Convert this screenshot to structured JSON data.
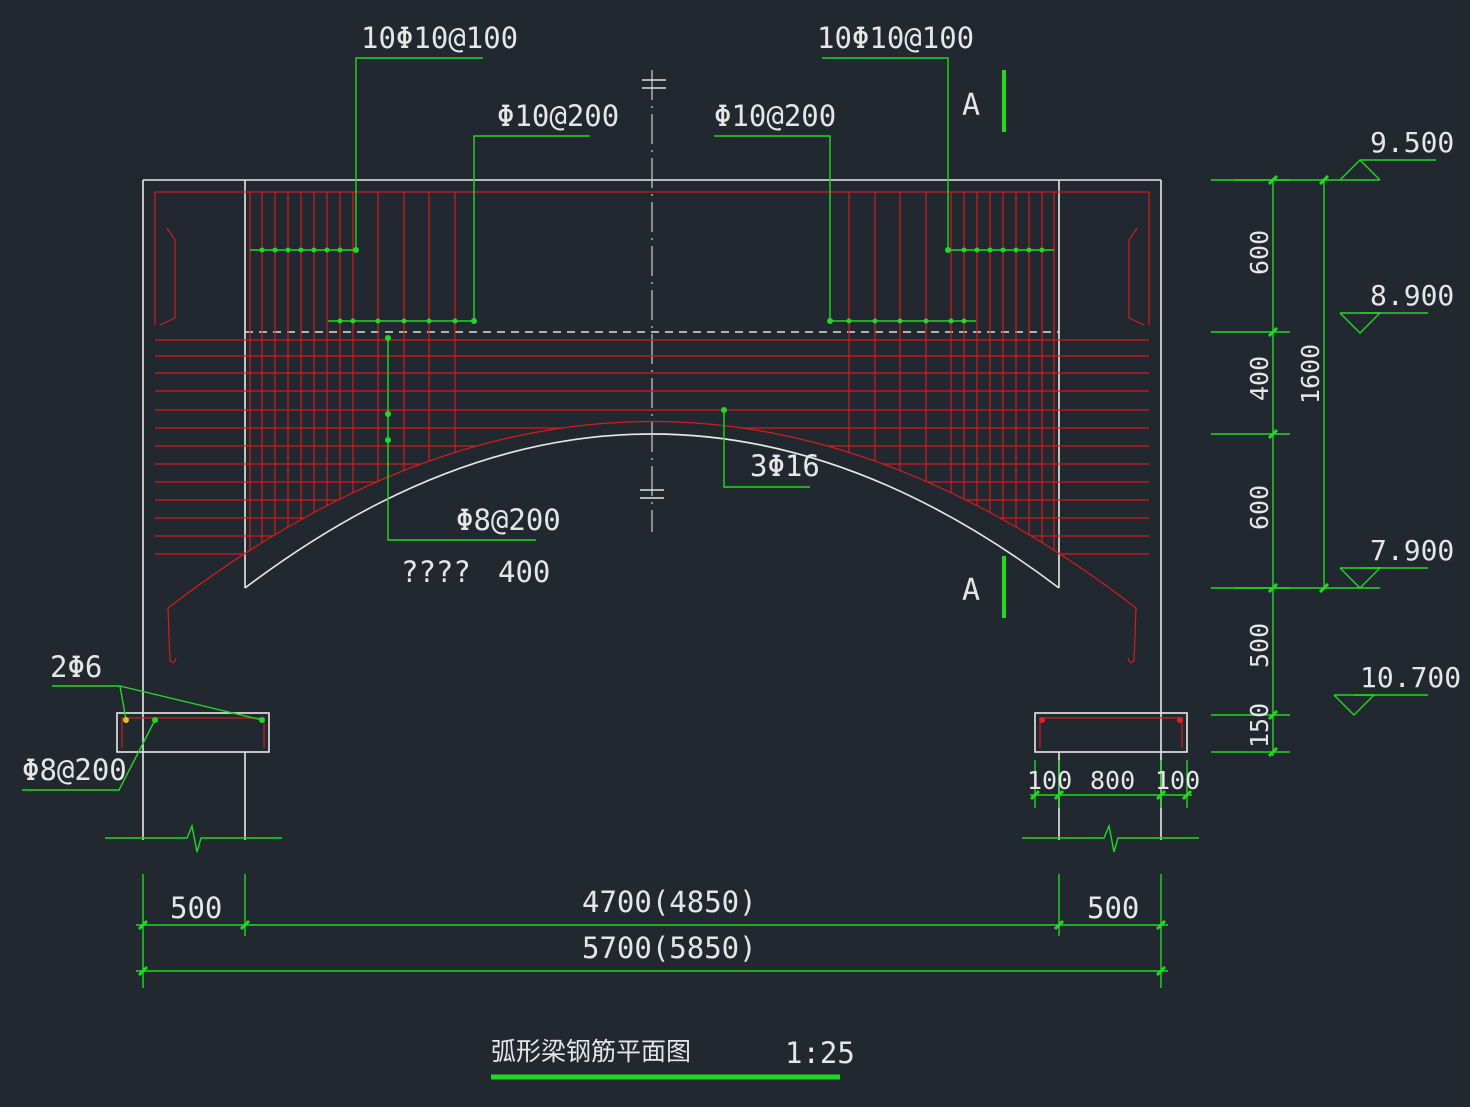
{
  "drawing": {
    "title": "弧形梁钢筋平面图",
    "scale": "1:25"
  },
  "rebar_labels": {
    "top_left_stirrups": "10Φ10@100",
    "top_right_stirrups": "10Φ10@100",
    "mid_left_stirrups": "Φ10@200",
    "mid_right_stirrups": "Φ10@200",
    "main_bars": "3Φ16",
    "web_bars": "Φ8@200",
    "unknown_text": "????",
    "web_spacing": "400",
    "foot_bars": "2Φ6",
    "foot_stirrups": "Φ8@200"
  },
  "section_marks": {
    "top": "A",
    "bottom": "A"
  },
  "elevations": [
    "9.500",
    "8.900",
    "7.900",
    "10.700"
  ],
  "vertical_dims": {
    "d1": "600",
    "d2": "400",
    "d3": "600",
    "d4": "500",
    "d5": "150",
    "total": "1600"
  },
  "foot_dims": [
    "100",
    "800",
    "100"
  ],
  "horizontal_dims": {
    "left": "500",
    "middle": "4700(4850)",
    "right": "500",
    "total": "5700(5850)"
  },
  "colors": {
    "background": "#212830",
    "outline": "#e8e8e8",
    "rebar": "#d41c1c",
    "dimension": "#22d822"
  }
}
